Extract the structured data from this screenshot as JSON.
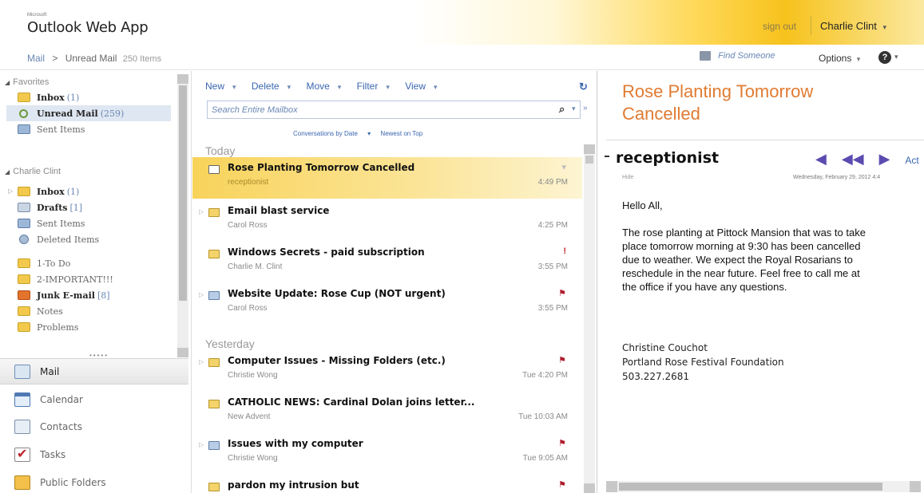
{
  "header": {
    "brand_small": "Microsoft",
    "app_title": "Outlook Web App",
    "sign_out": "sign out",
    "user_name": "Charlie Clint",
    "user_caret": "▾"
  },
  "breadcrumb": {
    "root": "Mail",
    "sep": ">",
    "current": "Unread Mail",
    "count": "250 Items",
    "find_someone": "Find Someone",
    "options": "Options",
    "help": "?"
  },
  "favorites": {
    "heading": "Favorites",
    "items": [
      {
        "label": "Inbox",
        "count": "(1)"
      },
      {
        "label": "Unread Mail",
        "count": "(259)"
      },
      {
        "label": "Sent Items",
        "count": ""
      }
    ]
  },
  "mailbox": {
    "heading": "Charlie Clint",
    "items": [
      {
        "label": "Inbox",
        "count": "(1)"
      },
      {
        "label": "Drafts",
        "count": "[1]"
      },
      {
        "label": "Sent Items",
        "count": ""
      },
      {
        "label": "Deleted Items",
        "count": ""
      },
      {
        "label": "1-To Do",
        "count": ""
      },
      {
        "label": "2-IMPORTANT!!!",
        "count": ""
      },
      {
        "label": "Junk E-mail",
        "count": "[8]"
      },
      {
        "label": "Notes",
        "count": ""
      },
      {
        "label": "Problems",
        "count": ""
      }
    ]
  },
  "nav_buttons": [
    {
      "label": "Mail"
    },
    {
      "label": "Calendar"
    },
    {
      "label": "Contacts"
    },
    {
      "label": "Tasks"
    },
    {
      "label": "Public Folders"
    }
  ],
  "list_toolbar": {
    "new": "New",
    "delete": "Delete",
    "move": "Move",
    "filter": "Filter",
    "view": "View",
    "caret": "▾"
  },
  "search": {
    "placeholder": "Search Entire Mailbox"
  },
  "sort": {
    "by": "Conversations by Date",
    "order": "Newest on Top"
  },
  "groups": {
    "today": "Today",
    "yesterday": "Yesterday"
  },
  "messages": [
    {
      "subject": "Rose Planting Tomorrow Cancelled",
      "sender": "receptionist",
      "time": "4:49 PM",
      "flag": "▾"
    },
    {
      "subject": "Email blast service",
      "sender": "Carol Ross",
      "time": "4:25 PM",
      "flag": ""
    },
    {
      "subject": "Windows Secrets - paid subscription",
      "sender": "Charlie M. Clint",
      "time": "3:55 PM",
      "flag": "!"
    },
    {
      "subject": "Website Update: Rose Cup (NOT urgent)",
      "sender": "Carol Ross",
      "time": "3:55 PM",
      "flag": "⚑"
    },
    {
      "subject": "Computer Issues - Missing Folders (etc.)",
      "sender": "Christie Wong",
      "time": "Tue 4:20 PM",
      "flag": "⚑"
    },
    {
      "subject": "CATHOLIC NEWS: Cardinal Dolan joins letter...",
      "sender": "New Advent",
      "time": "Tue 10:03 AM",
      "flag": ""
    },
    {
      "subject": "Issues with my computer",
      "sender": "Christie Wong",
      "time": "Tue 9:05 AM",
      "flag": "⚑"
    },
    {
      "subject": "pardon my intrusion but",
      "sender": "",
      "time": "",
      "flag": "⚑"
    }
  ],
  "reading": {
    "subject": "Rose Planting Tomorrow Cancelled",
    "from": "receptionist",
    "to": "Hide",
    "date": "Wednesday, February 29, 2012 4:4",
    "actions_label": "Act",
    "greeting": "Hello All,",
    "body_lines": [
      "The rose planting at Pittock Mansion that was to take",
      "place tomorrow morning at 9:30 has been cancelled",
      "due to weather.  We expect the Royal Rosarians to",
      "reschedule in the near future.  Feel free to call me at",
      "the office if you have any questions."
    ],
    "signature": [
      "Christine Couchot",
      "Portland Rose Festival Foundation",
      "503.227.2681"
    ]
  }
}
